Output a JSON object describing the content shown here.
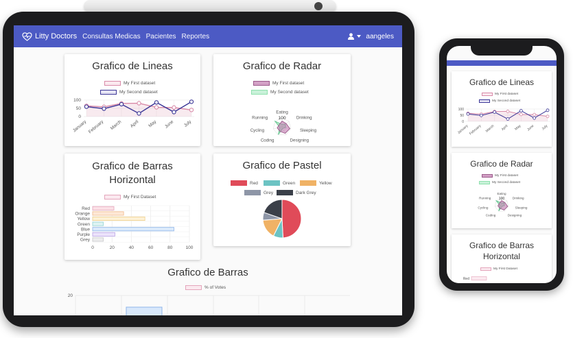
{
  "app": {
    "brand": "Litty Doctors",
    "nav": [
      "Consultas Medicas",
      "Pacientes",
      "Reportes"
    ],
    "user": "aangeles"
  },
  "lines_card": {
    "title": "Grafico de Lineas",
    "legend": [
      "My First dataset",
      "My Second dataset"
    ],
    "y_ticks": [
      "100",
      "50",
      "0"
    ],
    "x_ticks": [
      "January",
      "February",
      "March",
      "April",
      "May",
      "June",
      "July"
    ]
  },
  "radar_card": {
    "title": "Grafico de Radar",
    "legend": [
      "My First dataset",
      "My Second dataset"
    ],
    "labels": [
      "Eating",
      "Drinking",
      "Sleeping",
      "Designing",
      "Coding",
      "Cycling",
      "Running"
    ],
    "tick": "100"
  },
  "hbar_card": {
    "title": "Grafico de Barras Horizontal",
    "legend": "My First Dataset",
    "categories": [
      "Red",
      "Orange",
      "Yellow",
      "Green",
      "Blue",
      "Purple",
      "Grey"
    ],
    "x_ticks": [
      "0",
      "20",
      "40",
      "60",
      "80",
      "100"
    ]
  },
  "pie_card": {
    "title": "Grafico de Pastel",
    "legend": [
      "Red",
      "Green",
      "Yellow",
      "Grey",
      "Dark Grey"
    ]
  },
  "bar_card": {
    "title": "Grafico de Barras",
    "legend": "% of Votes",
    "y_tick": "20"
  },
  "phone": {
    "lines_title": "Grafico de Lineas",
    "radar_title": "Grafico de Radar",
    "hbar_title": "Grafico de Barras Horizontal",
    "legend_first": "My First dataset",
    "legend_second": "My Second dataset",
    "hbar_legend": "My First Dataset",
    "y_ticks": [
      "100",
      "50",
      "0"
    ],
    "x_ticks": [
      "January",
      "February",
      "March",
      "April",
      "May",
      "June",
      "July"
    ],
    "radar_labels": [
      "Eating",
      "Drinking",
      "Sleeping",
      "Designing",
      "Coding",
      "Cycling",
      "Running"
    ],
    "radar_tick": "100",
    "hbar_first_label": "Red"
  },
  "colors": {
    "navbar": "#4c5ac4",
    "series_pink": "#d98aa8",
    "series_navy": "#3a3596",
    "pie_red": "#e04b59",
    "pie_green": "#6cc3c3",
    "pie_yellow": "#f0b265",
    "pie_grey": "#8e96a7",
    "pie_dark": "#3b4049"
  },
  "chart_data": [
    {
      "type": "line",
      "categories": [
        "January",
        "February",
        "March",
        "April",
        "May",
        "June",
        "July"
      ],
      "series": [
        {
          "name": "My First dataset",
          "values": [
            65,
            59,
            80,
            81,
            56,
            55,
            40
          ]
        },
        {
          "name": "My Second dataset",
          "values": [
            60,
            48,
            75,
            19,
            86,
            27,
            90
          ]
        }
      ],
      "ylim": [
        0,
        100
      ]
    },
    {
      "type": "radar",
      "categories": [
        "Eating",
        "Drinking",
        "Sleeping",
        "Designing",
        "Coding",
        "Cycling",
        "Running"
      ],
      "series": [
        {
          "name": "My First dataset",
          "values": [
            65,
            59,
            90,
            81,
            56,
            55,
            40
          ]
        },
        {
          "name": "My Second dataset",
          "values": [
            28,
            48,
            40,
            19,
            96,
            27,
            100
          ]
        }
      ],
      "rlim": [
        0,
        100
      ]
    },
    {
      "type": "bar",
      "orientation": "horizontal",
      "categories": [
        "Red",
        "Orange",
        "Yellow",
        "Green",
        "Blue",
        "Purple",
        "Grey"
      ],
      "series": [
        {
          "name": "My First Dataset",
          "values": [
            22,
            32,
            54,
            11,
            84,
            23,
            11
          ]
        }
      ],
      "xlim": [
        0,
        100
      ]
    },
    {
      "type": "pie",
      "categories": [
        "Red",
        "Green",
        "Yellow",
        "Grey",
        "Dark Grey"
      ],
      "values": [
        300,
        50,
        100,
        40,
        120
      ]
    }
  ]
}
